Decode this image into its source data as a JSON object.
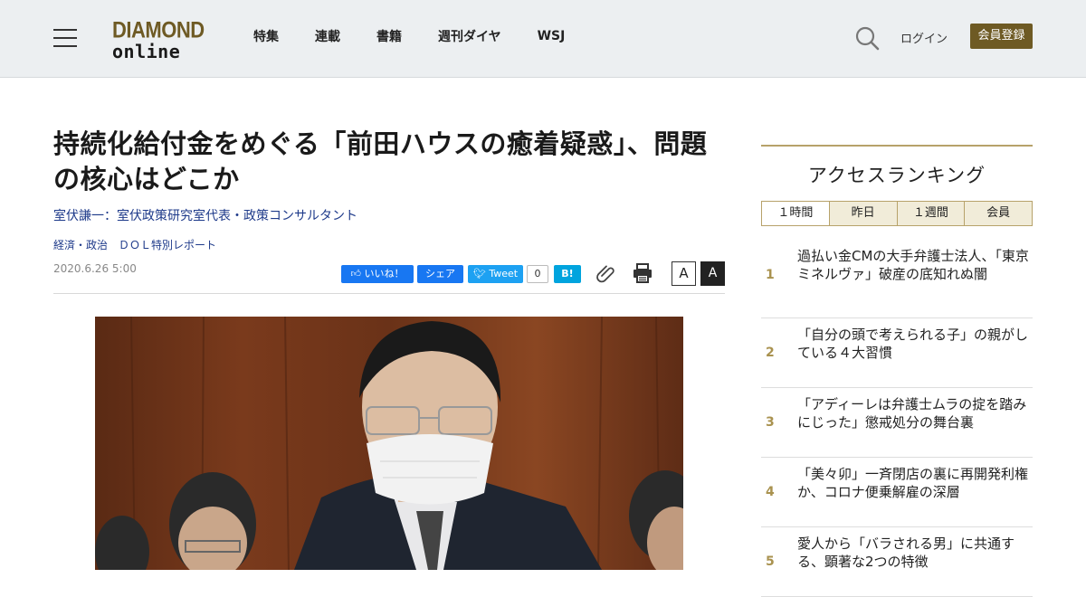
{
  "header": {
    "logo_top": "DIAMOND",
    "logo_bottom": "online",
    "nav": [
      "特集",
      "連載",
      "書籍",
      "週刊ダイヤ",
      "WSJ"
    ],
    "login": "ログイン",
    "register": "会員登録",
    "brand_color": "#6e5a24"
  },
  "article": {
    "title": "持続化給付金をめぐる「前田ハウスの癒着疑惑」、問題の核心はどこか",
    "author": "室伏謙一：室伏政策研究室代表・政策コンサルタント",
    "category": "経済・政治　ＤＯＬ特別レポート",
    "date": "2020.6.26 5:00",
    "share": {
      "like": "いいね！",
      "share": "シェア",
      "tweet": "Tweet",
      "tweet_count": "0",
      "hatena": "B!"
    },
    "font_small": "A",
    "font_large": "A"
  },
  "sidebar": {
    "title": "アクセスランキング",
    "tabs": [
      "１時間",
      "昨日",
      "１週間",
      "会員"
    ],
    "ranking": [
      {
        "rank": "1",
        "text": "過払い金CMの大手弁護士法人、「東京ミネルヴァ」破産の底知れぬ闇"
      },
      {
        "rank": "2",
        "text": "「自分の頭で考えられる子」の親がしている４大習慣"
      },
      {
        "rank": "3",
        "text": "「アディーレは弁護士ムラの掟を踏みにじった」懲戒処分の舞台裏"
      },
      {
        "rank": "4",
        "text": "「美々卯」一斉閉店の裏に再開発利権か、コロナ便乗解雇の深層"
      },
      {
        "rank": "5",
        "text": "愛人から「バラされる男」に共通する、顕著な2つの特徴"
      }
    ]
  }
}
